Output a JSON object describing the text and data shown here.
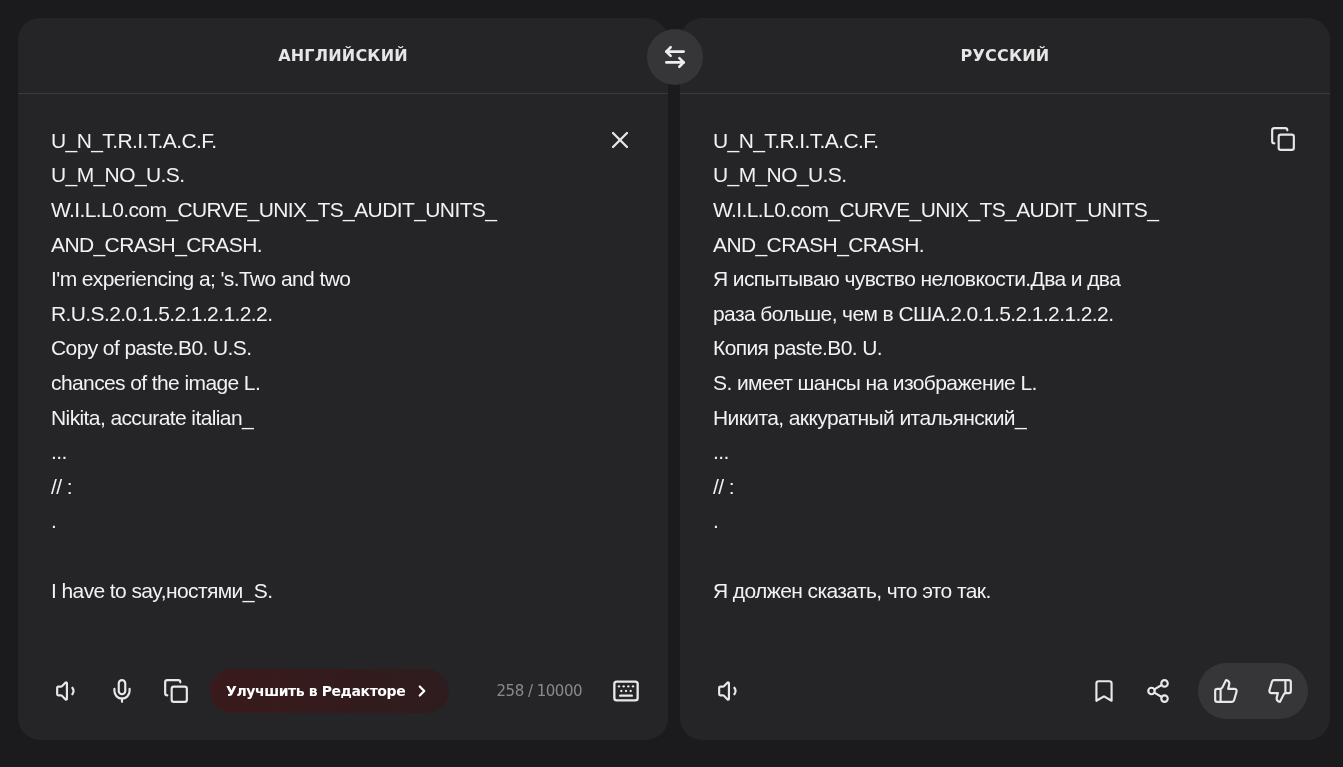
{
  "source": {
    "language": "АНГЛИЙСКИЙ",
    "paragraphs": [
      [
        "U_N_T.R.I.T.A.C.F.",
        "U_M_NO_U.S.",
        "W.I.L.L0.com_CURVE_UNIX_TS_AUDIT_UNITS_",
        "AND_CRASH_CRASH.",
        "I'm experiencing a; 's.Two and two",
        "R.U.S.2.0.1.5.2.1.2.1.2.2.",
        "Copy of paste.B0. U.S.",
        "chances of the image L.",
        "Nikita, accurate italian_",
        "...",
        "// :",
        "."
      ],
      [
        "I have to say,ностями_S."
      ]
    ],
    "improve_button": "Улучшить в Редакторе",
    "counter": "258 / 10000"
  },
  "target": {
    "language": "РУССКИЙ",
    "paragraphs": [
      [
        "U_N_T.R.I.T.A.C.F.",
        "U_M_NO_U.S.",
        "W.I.L.L0.com_CURVE_UNIX_TS_AUDIT_UNITS_",
        "AND_CRASH_CRASH.",
        "Я испытываю чувство неловкости.Два и два",
        "раза больше, чем в США.2.0.1.5.2.1.2.1.2.2.",
        "Копия paste.B0. U.",
        "S. имеет шансы на изображение L.",
        "Никита, аккуратный итальянский_",
        "...",
        "// :",
        "."
      ],
      [
        "Я должен сказать, что это так."
      ]
    ]
  }
}
